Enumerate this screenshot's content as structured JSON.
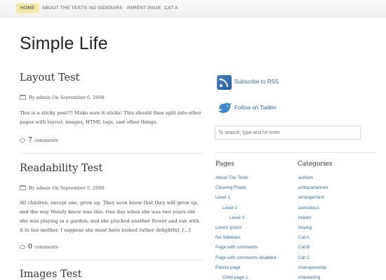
{
  "nav": {
    "items": [
      {
        "label": "HOME",
        "active": true
      },
      {
        "label": "ABOUT THE TESTS",
        "active": false
      },
      {
        "label": "NO SIDEBARS",
        "active": false
      },
      {
        "label": "PARENT PAGE",
        "active": false
      },
      {
        "label": "CAT A",
        "active": false
      }
    ]
  },
  "site": {
    "title": "Simple Life"
  },
  "posts": [
    {
      "title": "Layout Test",
      "meta": "By admin On September 6, 2008",
      "excerpt": "This is a sticky post!!! Make sure it sticks! This should then split into other pages with layout, images, HTML tags, and other things.",
      "comment_count": "7",
      "comment_label": "comments"
    },
    {
      "title": "Readability Test",
      "meta": "By admin On September 5, 2008",
      "excerpt": "All children, except one, grow up. They soon know that they will grow up, and the way Wendy knew was this. One day when she was two years old she was playing in a garden, and she plucked another flower and ran with it to her mother. I suppose she must have looked rather delightful, [...]",
      "comment_count": "0",
      "comment_label": "comments"
    },
    {
      "title": "Images Test"
    }
  ],
  "sidebar": {
    "rss_label": "Subscribe to RSS",
    "twitter_label": "Follow on Twitter",
    "search_placeholder": "To search, type and hit enter",
    "pages_title": "Pages",
    "pages": [
      {
        "label": "About The Tests",
        "indent": 0
      },
      {
        "label": "Clearing Floats",
        "indent": 0
      },
      {
        "label": "Level 1",
        "indent": 0
      },
      {
        "label": "Level 2",
        "indent": 1
      },
      {
        "label": "Level 3",
        "indent": 2
      },
      {
        "label": "Lorem Ipsum",
        "indent": 0
      },
      {
        "label": "No Sidebars",
        "indent": 0
      },
      {
        "label": "Page with comments",
        "indent": 0
      },
      {
        "label": "Page with comments disabled",
        "indent": 0
      },
      {
        "label": "Parent page",
        "indent": 0
      },
      {
        "label": "Child page 1",
        "indent": 1
      }
    ],
    "categories_title": "Categories",
    "categories": [
      "aciform",
      "antiquarianism",
      "arrangement",
      "asmodeus",
      "broder",
      "buying",
      "Cat A",
      "Cat B",
      "Cat C",
      "championship",
      "chastening"
    ]
  },
  "colors": {
    "link": "#2f6fa6",
    "nav_active_bg": "#f3eaa8"
  }
}
